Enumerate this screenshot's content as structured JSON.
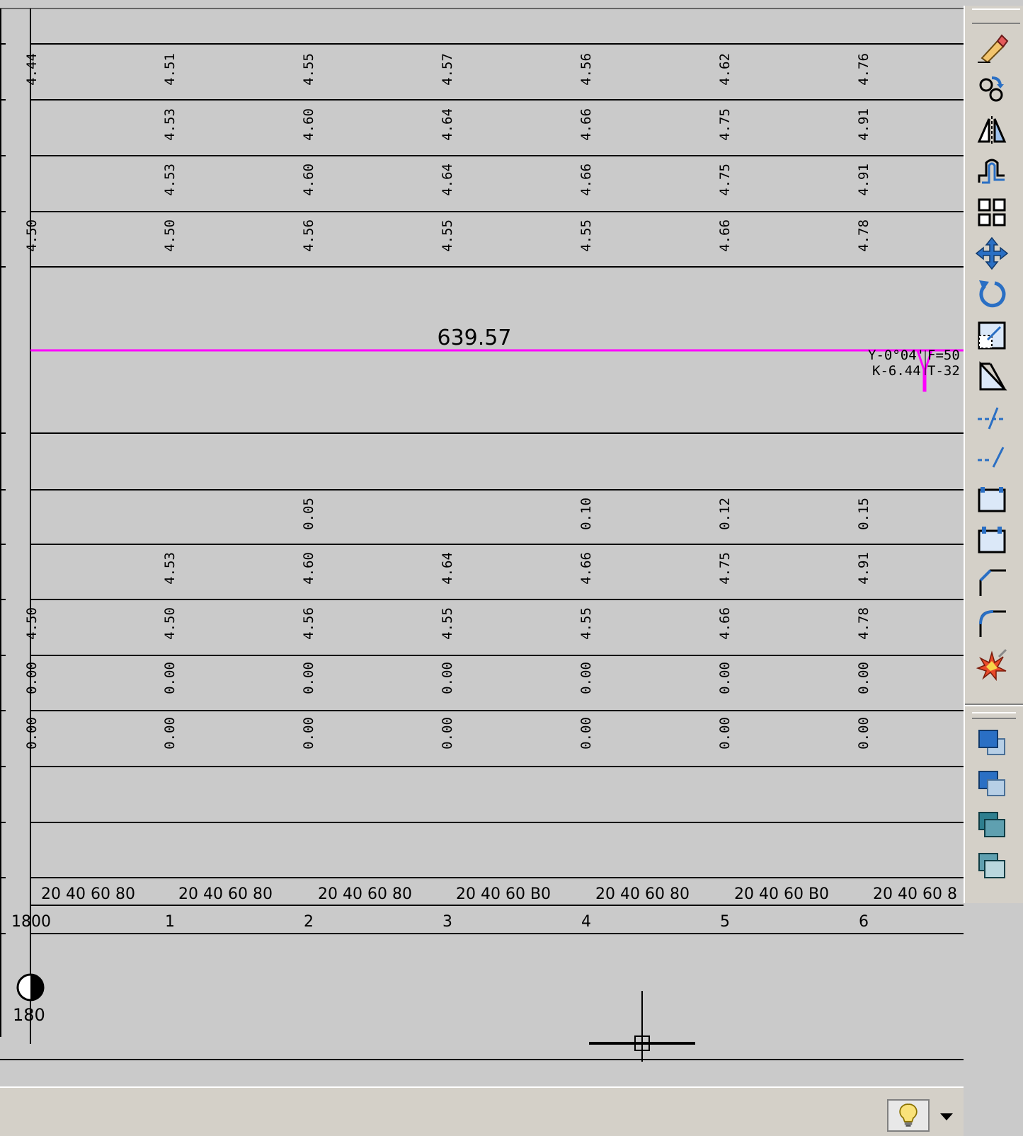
{
  "table": {
    "rows": [
      {
        "left": "4.44",
        "values": [
          "4.51",
          "4.55",
          "4.57",
          "4.56",
          "4.62",
          "4.76"
        ]
      },
      {
        "left": "",
        "values": [
          "4.53",
          "4.60",
          "4.64",
          "4.66",
          "4.75",
          "4.91"
        ]
      },
      {
        "left": "",
        "values": [
          "4.53",
          "4.60",
          "4.64",
          "4.66",
          "4.75",
          "4.91"
        ]
      },
      {
        "left": "4.50",
        "values": [
          "4.50",
          "4.56",
          "4.55",
          "4.55",
          "4.66",
          "4.78"
        ]
      },
      {
        "left": "",
        "values": [
          "",
          "0.05",
          "",
          "0.10",
          "0.12",
          "0.15"
        ]
      },
      {
        "left": "",
        "values": [
          "4.53",
          "4.60",
          "4.64",
          "4.66",
          "4.75",
          "4.91"
        ]
      },
      {
        "left": "4.50",
        "values": [
          "4.50",
          "4.56",
          "4.55",
          "4.55",
          "4.66",
          "4.78"
        ]
      },
      {
        "left": "0.00",
        "values": [
          "0.00",
          "0.00",
          "0.00",
          "0.00",
          "0.00",
          "0.00"
        ]
      },
      {
        "left": "0.00",
        "values": [
          "0.00",
          "0.00",
          "0.00",
          "0.00",
          "0.00",
          "0.00"
        ]
      }
    ]
  },
  "profile": {
    "length_label": "639.57",
    "curve_labels": [
      "Y-0°04'",
      "F=50",
      "K-6.44",
      "T-32"
    ]
  },
  "ruler": {
    "sub_ticks": [
      "20 40 60 80",
      "20 40 60 80",
      "20 40 60 80",
      "20 40 60 B0",
      "20 40 60 80",
      "20 40 60 B0",
      "20 40 60 8"
    ],
    "station_start": "1800",
    "stations": [
      "1",
      "2",
      "3",
      "4",
      "5",
      "6"
    ]
  },
  "north_marker": {
    "label": "180"
  },
  "toolbar": {
    "modify_tools": [
      "erase-icon",
      "copy-icon",
      "mirror-icon",
      "offset-icon",
      "array-icon",
      "move-icon",
      "rotate-icon",
      "scale-icon",
      "stretch-icon",
      "trim-icon",
      "extend-icon",
      "break-at-point-icon",
      "break-icon",
      "chamfer-icon",
      "fillet-icon",
      "explode-icon"
    ],
    "draworder_tools": [
      "bring-to-front-icon",
      "send-to-back-icon",
      "bring-above-icon",
      "send-under-icon"
    ]
  },
  "colors": {
    "background": "#cacaca",
    "grid_line": "#000000",
    "profile_line": "#ff00ff",
    "icon_blue": "#2a6fc4"
  }
}
